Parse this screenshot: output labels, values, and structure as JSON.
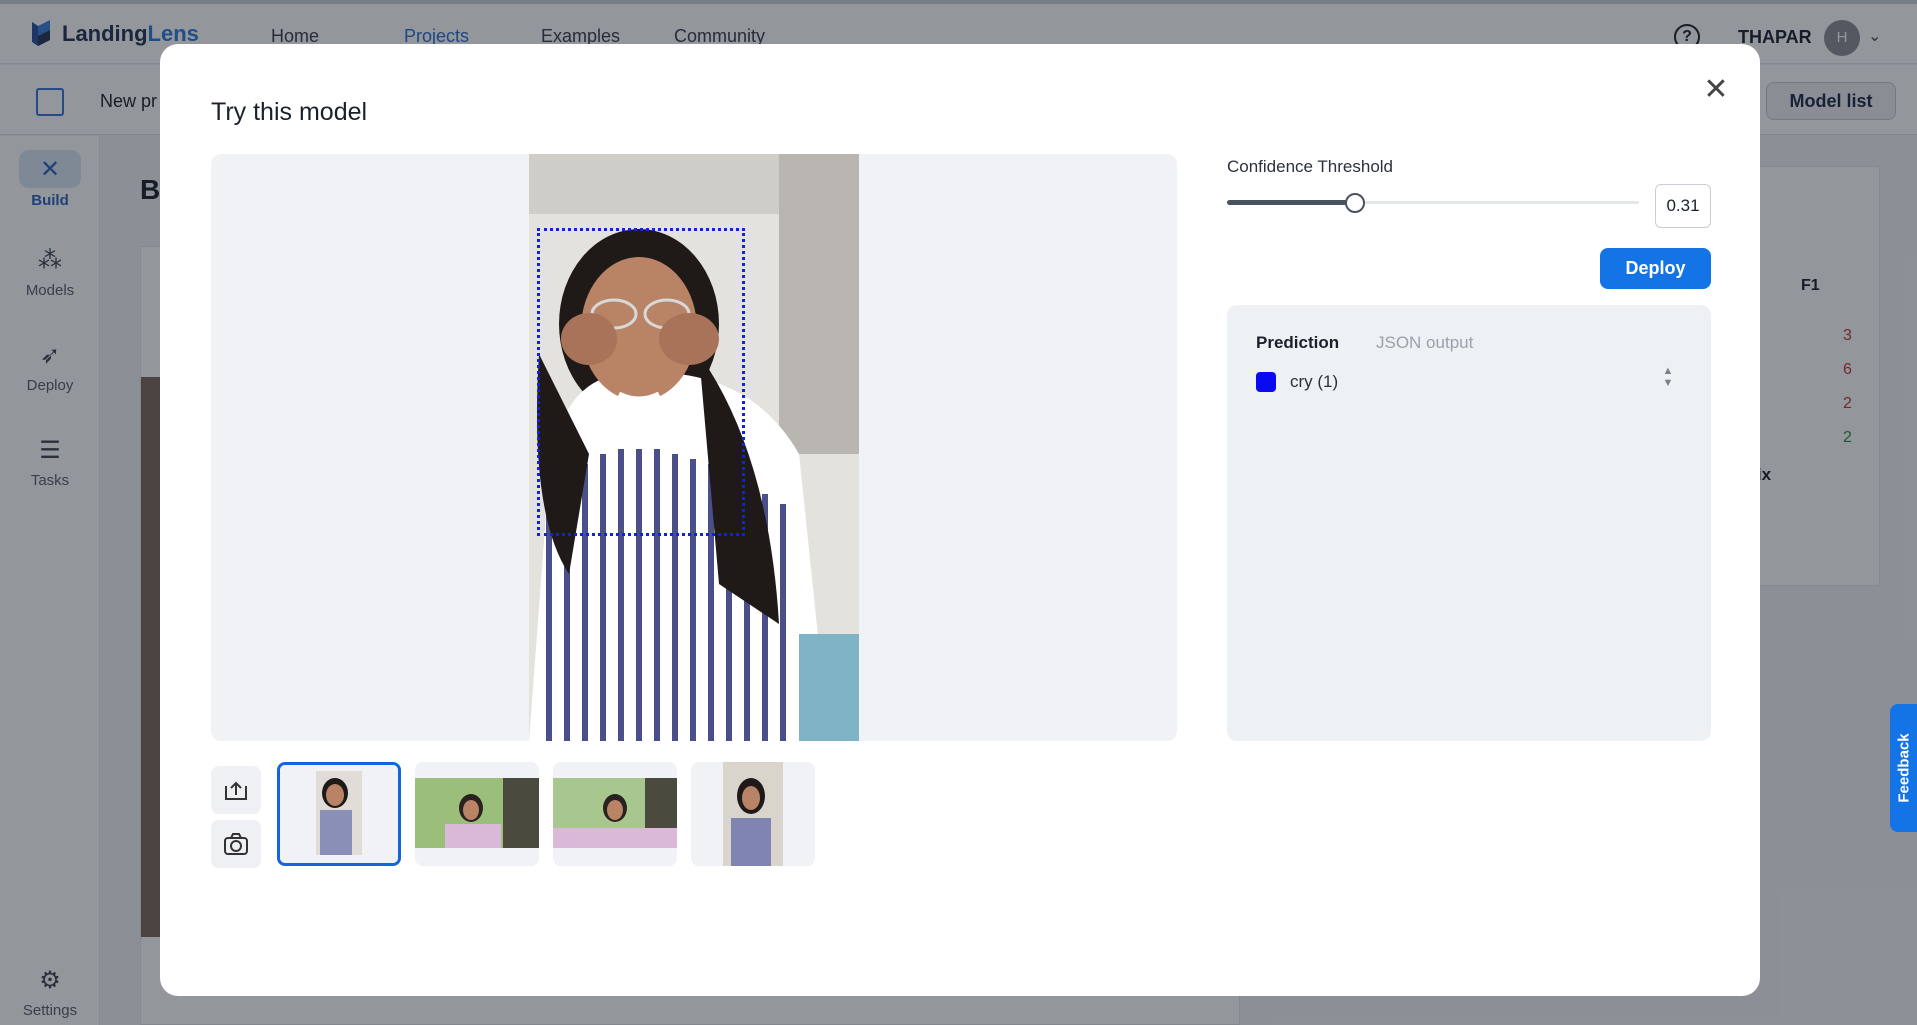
{
  "app": {
    "logo_text_primary": "Landing",
    "logo_text_accent": "Lens",
    "nav": [
      "Home",
      "Projects",
      "Examples",
      "Community"
    ],
    "active_nav": "Projects",
    "user_name": "THAPAR",
    "avatar_initial": "H",
    "help_label": "?"
  },
  "subbar": {
    "project_name": "New pr",
    "model_list_label": "Model list"
  },
  "sidebar": {
    "items": [
      {
        "label": "Build",
        "icon": "build-tools-icon",
        "active": true
      },
      {
        "label": "Models",
        "icon": "models-icon",
        "active": false
      },
      {
        "label": "Deploy",
        "icon": "rocket-icon",
        "active": false
      },
      {
        "label": "Tasks",
        "icon": "tasks-icon",
        "active": false
      }
    ],
    "settings_label": "Settings"
  },
  "background": {
    "heading_fragment": "B",
    "metric_label": "F1",
    "metric_values": [
      "3",
      "6",
      "2",
      "2"
    ],
    "matrix_label": "Matrix"
  },
  "modal": {
    "title": "Try this model",
    "close_icon": "close-icon",
    "confidence_label": "Confidence Threshold",
    "confidence_value": "0.31",
    "confidence_fraction": 0.31,
    "deploy_label": "Deploy",
    "tabs": {
      "prediction": "Prediction",
      "json_output": "JSON output"
    },
    "predictions": [
      {
        "label": "cry (1)",
        "color": "#0a0af0"
      }
    ],
    "thumbnails": 4,
    "upload_icon": "upload-icon",
    "camera_icon": "camera-icon"
  },
  "feedback_label": "Feedback",
  "colors": {
    "accent": "#1474e6",
    "bbox": "#1020e8"
  }
}
